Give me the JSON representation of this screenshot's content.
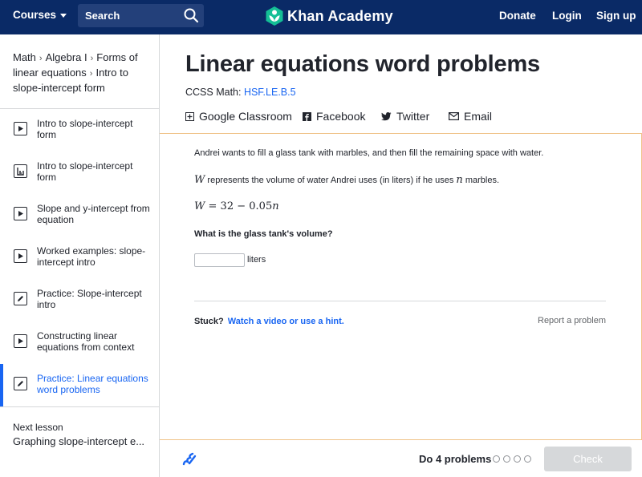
{
  "header": {
    "courses_label": "Courses",
    "search_placeholder": "Search",
    "logo_text": "Khan Academy",
    "donate": "Donate",
    "login": "Login",
    "signup": "Sign up",
    "bg_color": "#0a2a66",
    "logo_color": "#14bf96"
  },
  "sidebar": {
    "breadcrumb": [
      "Math",
      "Algebra I",
      "Forms of linear equations",
      "Intro to slope-intercept form"
    ],
    "items": [
      {
        "icon": "play-icon",
        "label": "Intro to slope-intercept form"
      },
      {
        "icon": "article-icon",
        "label": "Intro to slope-intercept form"
      },
      {
        "icon": "play-icon",
        "label": "Slope and y-intercept from equation"
      },
      {
        "icon": "play-icon",
        "label": "Worked examples: slope-intercept intro"
      },
      {
        "icon": "pencil-icon",
        "label": "Practice: Slope-intercept intro"
      },
      {
        "icon": "play-icon",
        "label": "Constructing linear equations from context"
      },
      {
        "icon": "pencil-icon",
        "label": "Practice: Linear equations word problems",
        "active": true
      }
    ],
    "next_label": "Next lesson",
    "next_title": "Graphing slope-intercept e..."
  },
  "main": {
    "title": "Linear equations word problems",
    "ccss_prefix": "CCSS Math: ",
    "ccss_code": "HSF.LE.B.5",
    "share": {
      "google": "Google Classroom",
      "facebook": "Facebook",
      "twitter": "Twitter",
      "email": "Email"
    }
  },
  "exercise": {
    "intro": "Andrei wants to fill a glass tank with marbles, and then fill the remaining space with water.",
    "var_w": "W",
    "line2_mid": " represents the volume of water Andrei uses (in liters) if he uses ",
    "var_n": "n",
    "line2_end": " marbles.",
    "equation": {
      "lhs": "W",
      "rhs_const": "32",
      "rhs_coef": "0.05",
      "rhs_var": "n"
    },
    "question": "What is the glass tank's volume?",
    "answer_value": "",
    "unit": "liters",
    "stuck": "Stuck?",
    "hint_link": "Watch a video or use a hint.",
    "report": "Report a problem"
  },
  "footer": {
    "do_problems": "Do 4 problems",
    "check": "Check",
    "accent_color": "#1865f2"
  }
}
